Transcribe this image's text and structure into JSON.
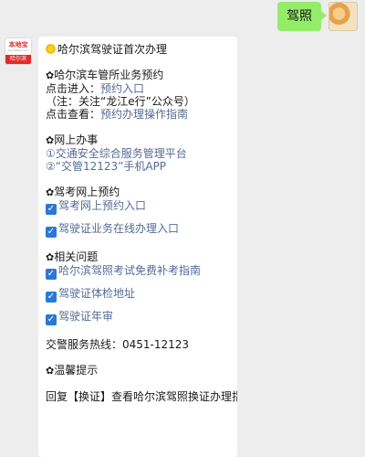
{
  "sent_message": {
    "text": "驾照"
  },
  "bot": {
    "brand": "本地宝",
    "brand_sub": "bendibao.com",
    "city": "哈尔滨"
  },
  "bubble": {
    "title": "哈尔滨驾驶证首次办理",
    "s1_heading": "哈尔滨车管所业务预约",
    "s1_l1_prefix": "点击进入：",
    "s1_l1_link": "预约入口",
    "s1_note": "（注：关注“龙江e行”公众号）",
    "s1_l3_prefix": "点击查看：",
    "s1_l3_link": "预约办理操作指南",
    "s2_heading": "网上办事",
    "s2_item1": "①交通安全综合服务管理平台",
    "s2_item2": "②“交管12123”手机APP",
    "s3_heading": "驾考网上预约",
    "s3_link1": "驾考网上预约入口",
    "s3_link2": "驾驶证业务在线办理入口",
    "s4_heading": "相关问题",
    "s4_link1": "哈尔滨驾照考试免费补考指南",
    "s4_link2": "驾驶证体检地址",
    "s4_link3": "驾驶证年审",
    "hotline": "交警服务热线：0451-12123",
    "tips_heading": "温馨提示",
    "tips_text": "回复【换证】查看哈尔滨驾照换证办理指南"
  },
  "icons": {
    "check": "checkbox-icon",
    "flower": "flower-bullet-icon",
    "sun": "sun-icon"
  },
  "colors": {
    "sent_bubble": "#95ec69",
    "link": "#576b95",
    "background": "#ededed",
    "check": "#2b78d6"
  }
}
